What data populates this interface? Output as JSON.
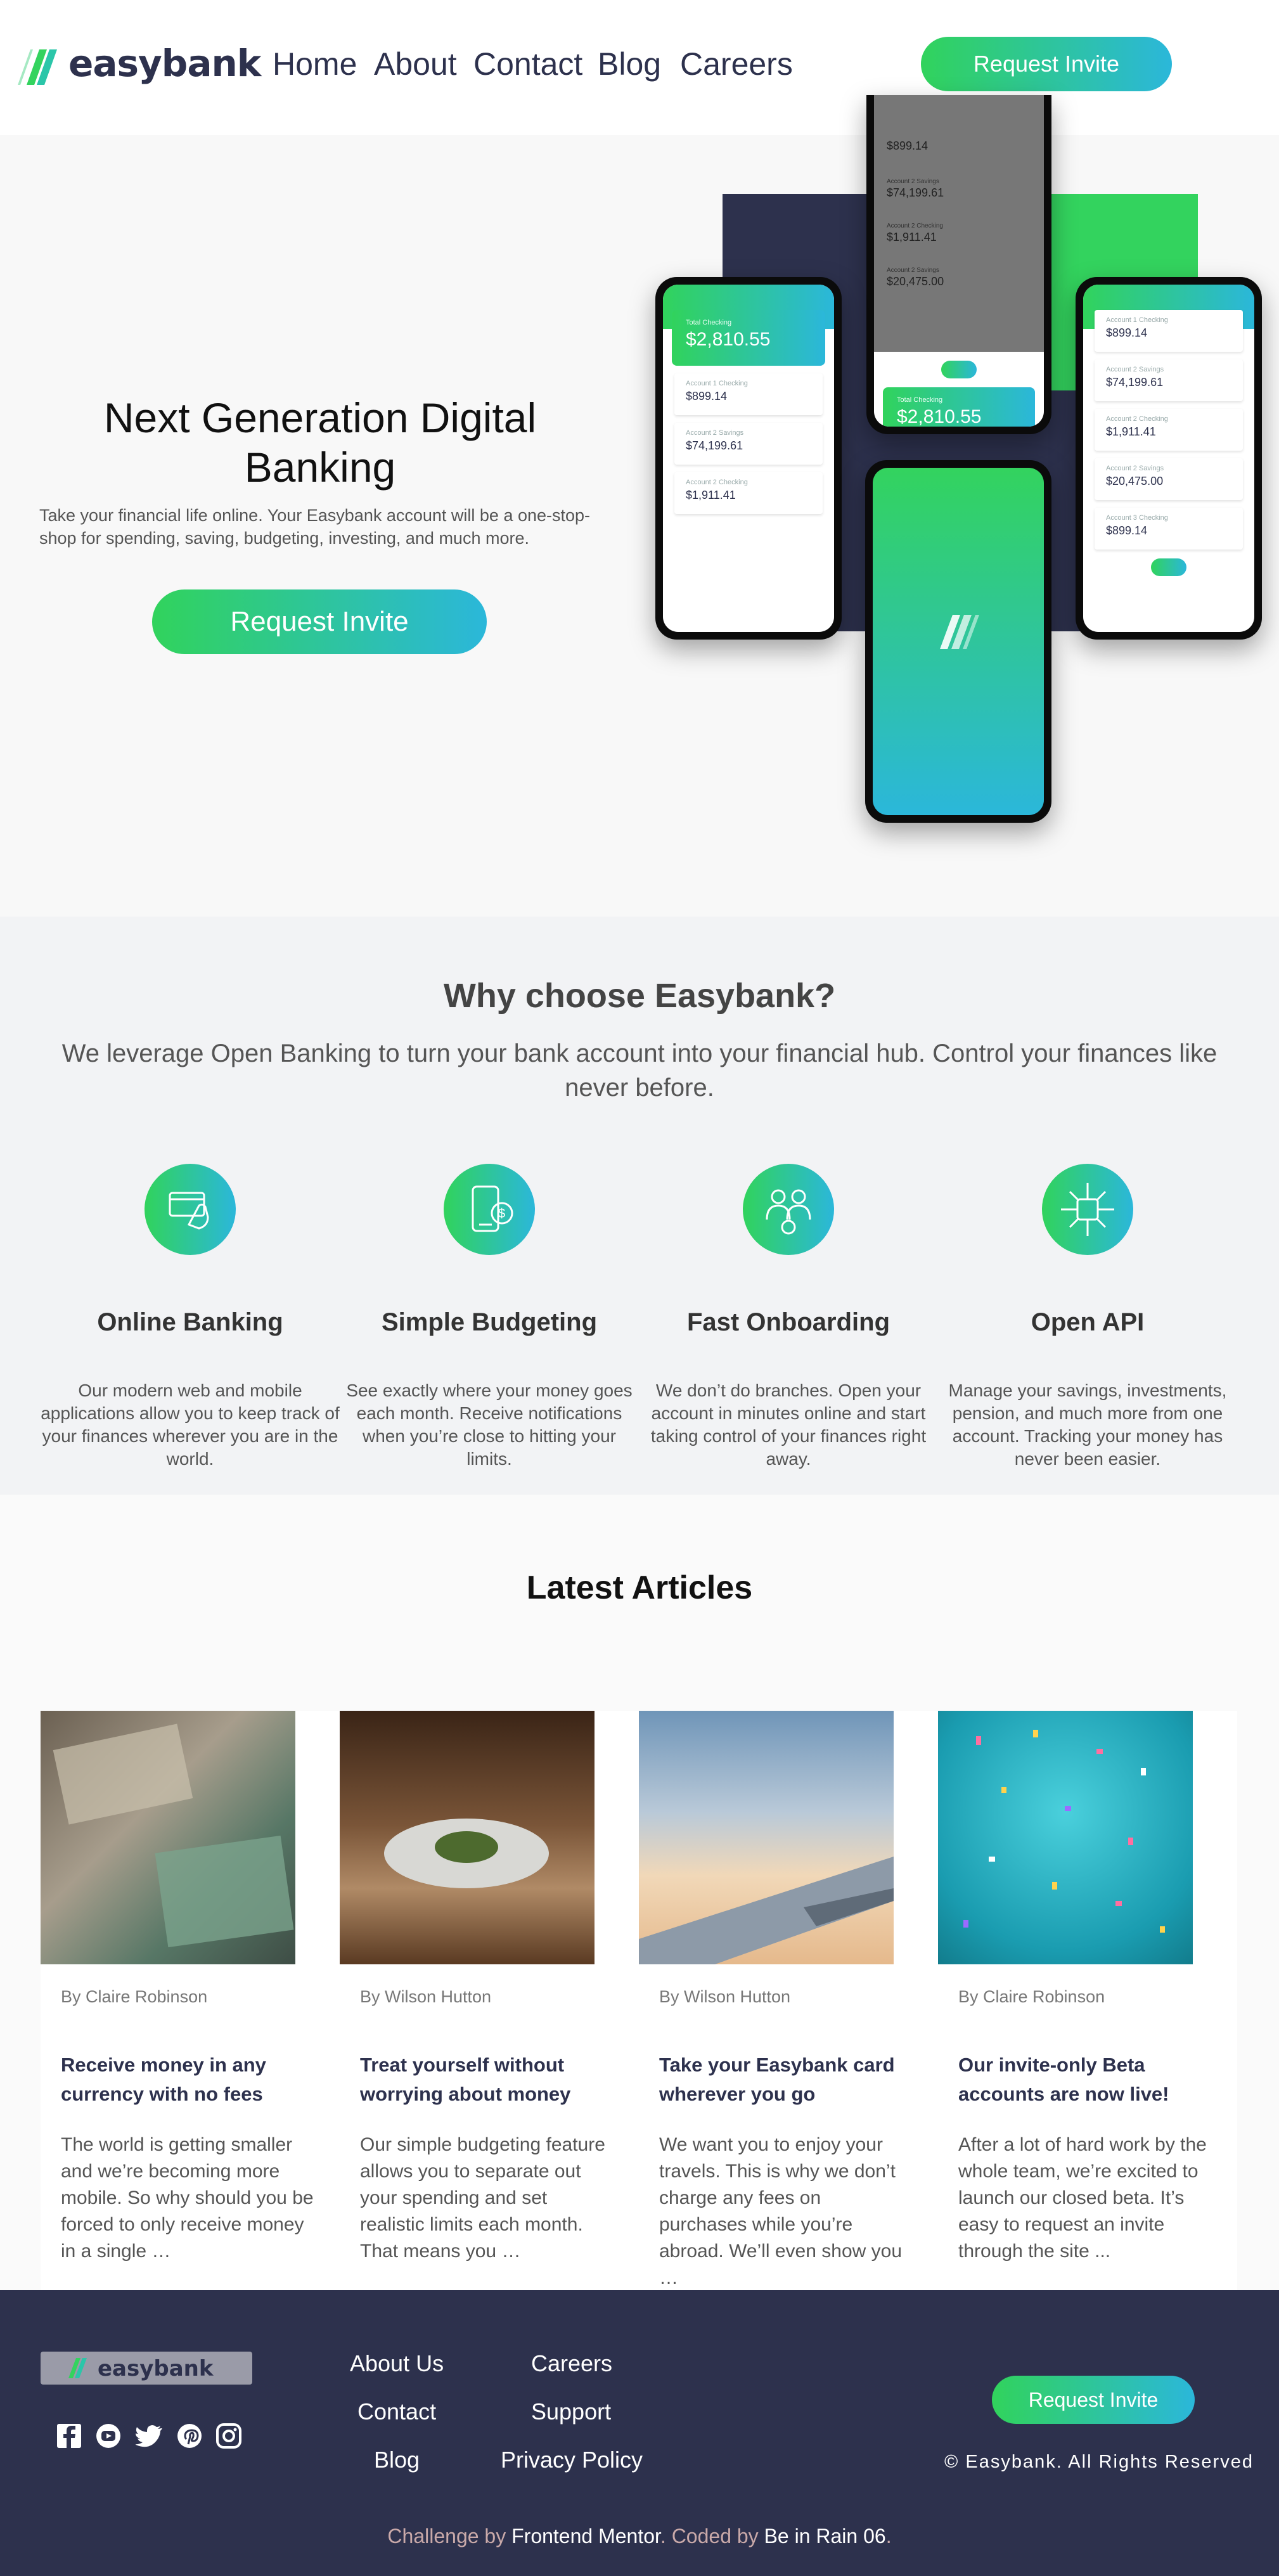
{
  "brand": {
    "name": "easybank",
    "primary_color": "#2d314d",
    "gradient_from": "#31d35c",
    "gradient_to": "#2bb7da"
  },
  "nav": {
    "items": [
      "Home",
      "About",
      "Contact",
      "Blog",
      "Careers"
    ],
    "cta": "Request Invite"
  },
  "hero": {
    "title": "Next Generation Digital Banking",
    "description": "Take your financial life online. Your Easybank account will be a one-stop-shop for spending, saving, budgeting, investing, and much more.",
    "cta": "Request Invite",
    "phone": {
      "total_label": "Total Checking",
      "total_value": "$2,810.55",
      "accounts": [
        {
          "label": "Account 1 Checking",
          "value": "$899.14"
        },
        {
          "label": "Account 2 Savings",
          "value": "$74,199.61"
        },
        {
          "label": "Account 2 Checking",
          "value": "$1,911.41"
        },
        {
          "label": "Account 2 Savings",
          "value": "$20,475.00"
        },
        {
          "label": "Account 3 Checking",
          "value": "$899.14"
        }
      ]
    }
  },
  "why": {
    "title": "Why choose Easybank?",
    "subtitle": "We leverage Open Banking to turn your bank account into your financial hub. Control your finances like never before.",
    "features": [
      {
        "icon": "online-banking-icon",
        "title": "Online Banking",
        "text": "Our modern web and mobile applications allow you to keep track of your finances wherever you are in the world."
      },
      {
        "icon": "budgeting-icon",
        "title": "Simple Budgeting",
        "text": "See exactly where your money goes each month. Receive notifications when you’re close to hitting your limits."
      },
      {
        "icon": "onboarding-icon",
        "title": "Fast Onboarding",
        "text": "We don’t do branches. Open your account in minutes online and start taking control of your finances right away."
      },
      {
        "icon": "api-icon",
        "title": "Open API",
        "text": "Manage your savings, investments, pension, and much more from one account. Tracking your money has never been easier."
      }
    ]
  },
  "articles": {
    "title": "Latest Articles",
    "items": [
      {
        "author": "By Claire Robinson",
        "title": "Receive money in any currency with no fees",
        "excerpt": "The world is getting smaller and we’re becoming more mobile. So why should you be forced to only receive money in a single …"
      },
      {
        "author": "By Wilson Hutton",
        "title": "Treat yourself without worrying about money",
        "excerpt": "Our simple budgeting feature allows you to separate out your spending and set realistic limits each month. That means you …"
      },
      {
        "author": "By Wilson Hutton",
        "title": "Take your Easybank card wherever you go",
        "excerpt": "We want you to enjoy your travels. This is why we don’t charge any fees on purchases while you’re abroad. We’ll even show you …"
      },
      {
        "author": "By Claire Robinson",
        "title": "Our invite-only Beta accounts are now live!",
        "excerpt": "After a lot of hard work by the whole team, we’re excited to launch our closed beta. It’s easy to request an invite through the site ..."
      }
    ]
  },
  "footer": {
    "links_col1": [
      "About Us",
      "Contact",
      "Blog"
    ],
    "links_col2": [
      "Careers",
      "Support",
      "Privacy Policy"
    ],
    "socials": [
      "facebook-icon",
      "youtube-icon",
      "twitter-icon",
      "pinterest-icon",
      "instagram-icon"
    ],
    "cta": "Request Invite",
    "copyright": "© Easybank. All Rights Reserved",
    "credit_pre": "Challenge by ",
    "credit_link1": "Frontend Mentor",
    "credit_mid": ". Coded by ",
    "credit_link2": "Be in Rain 06",
    "credit_end": "."
  }
}
